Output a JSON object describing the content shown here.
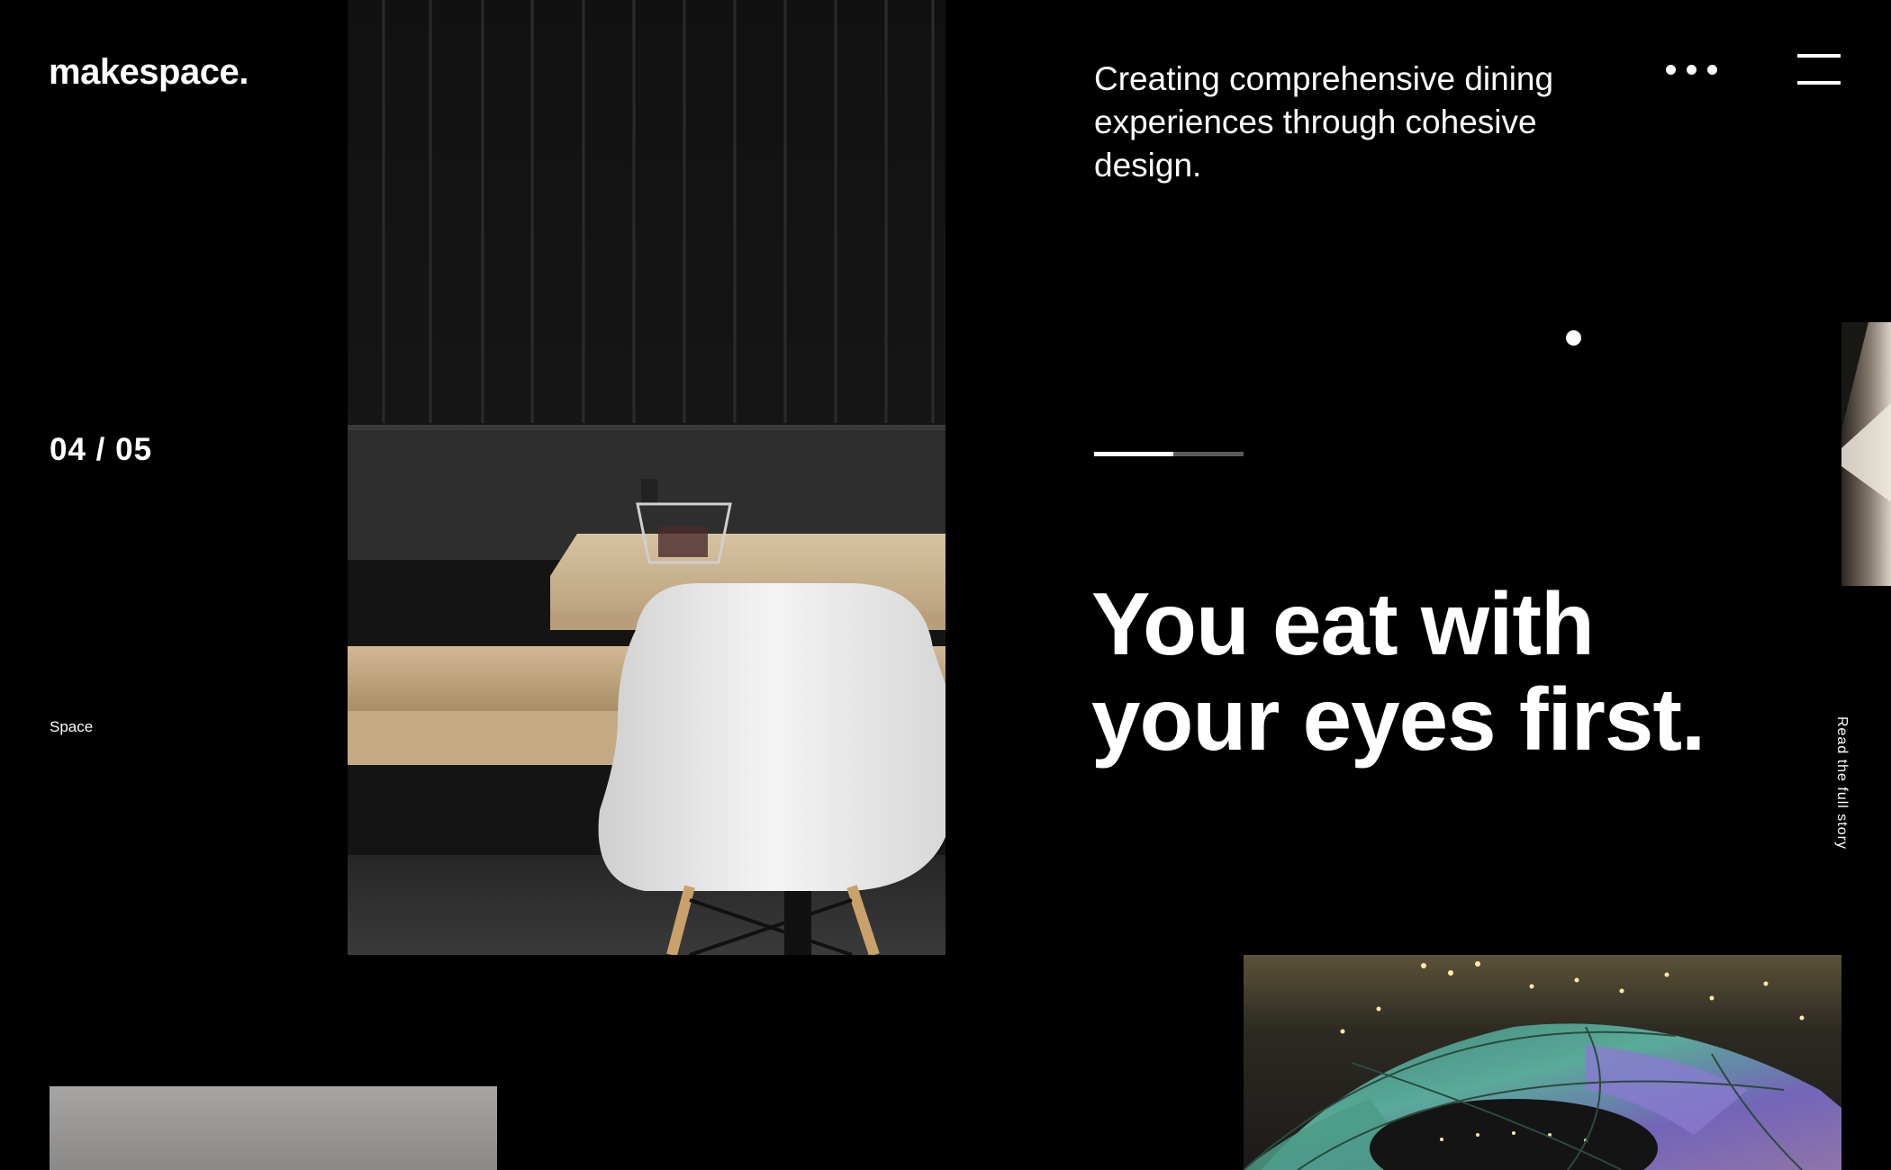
{
  "brand": {
    "logo_text": "makespace."
  },
  "slider": {
    "counter": "04 / 05",
    "section": "Space",
    "progress": 0.53
  },
  "hero": {
    "tagline": "Creating comprehensive dining experiences through cohesive design.",
    "headline_line1": "You eat with",
    "headline_line2": "your eyes first.",
    "read_more": "Read the full story"
  },
  "controls": {
    "more_icon": "more-dots-icon",
    "menu_icon": "hamburger-menu-icon"
  },
  "images": [
    {
      "id": "main",
      "subject": "dining booth with white chair"
    },
    {
      "id": "dome",
      "subject": "iridescent dome structure"
    },
    {
      "id": "peek",
      "subject": "next slide image"
    },
    {
      "id": "thumb",
      "subject": "grey thumbnail"
    }
  ],
  "colors": {
    "background": "#000000",
    "text": "#ffffff",
    "progress_track": "#5a5a5a"
  }
}
